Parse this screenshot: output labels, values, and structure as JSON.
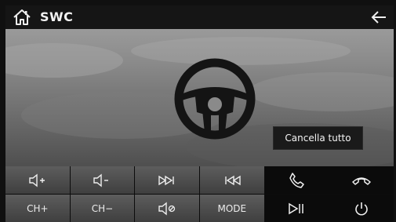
{
  "header": {
    "title": "SWC",
    "home_icon": "home-icon",
    "back_icon": "back-arrow-icon"
  },
  "main": {
    "center_icon": "steering-wheel-icon",
    "clear_all_label": "Cancella tutto"
  },
  "controls": {
    "row1": [
      {
        "icon": "volume-up-icon"
      },
      {
        "icon": "volume-down-icon"
      },
      {
        "icon": "next-track-icon"
      },
      {
        "icon": "previous-track-icon"
      },
      {
        "icon": "phone-answer-icon"
      },
      {
        "icon": "phone-hangup-icon"
      }
    ],
    "row2": [
      {
        "label": "CH+"
      },
      {
        "label": "CH−"
      },
      {
        "icon": "mute-icon"
      },
      {
        "label": "MODE"
      },
      {
        "icon": "play-pause-icon"
      },
      {
        "icon": "power-icon"
      }
    ]
  },
  "colors": {
    "background": "#101010",
    "key_grey": "#4e4e4e",
    "text": "#ececec"
  }
}
